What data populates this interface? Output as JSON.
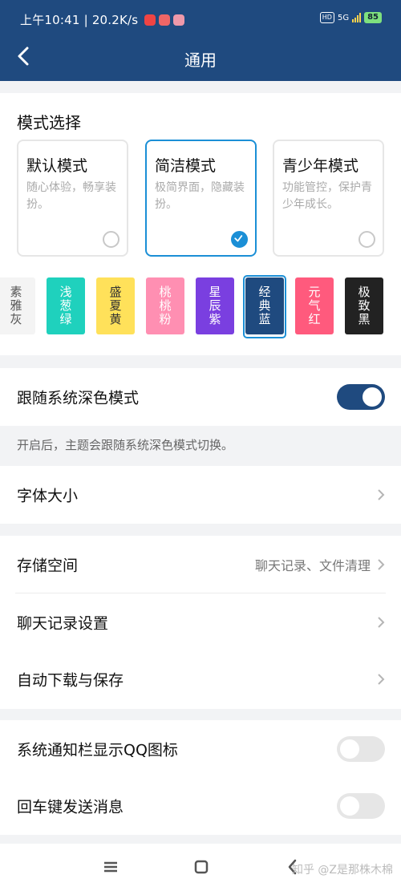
{
  "status_bar": {
    "time_speed": "上午10:41 | 20.2K/s",
    "network_label": "5G",
    "hd_label": "HD",
    "battery": "85"
  },
  "header": {
    "title": "通用"
  },
  "mode_section": {
    "title": "模式选择",
    "modes": [
      {
        "title": "默认模式",
        "desc": "随心体验，畅享装扮。",
        "selected": false
      },
      {
        "title": "简洁模式",
        "desc": "极简界面，隐藏装扮。",
        "selected": true
      },
      {
        "title": "青少年模式",
        "desc": "功能管控，保护青少年成长。",
        "selected": false
      }
    ],
    "themes": [
      {
        "label": "素雅灰",
        "color": "#f4f4f4",
        "text_color": "#555"
      },
      {
        "label": "浅葱绿",
        "color": "#1fd1bd",
        "text_color": "#ffffff"
      },
      {
        "label": "盛夏黄",
        "color": "#ffe15a",
        "text_color": "#333333"
      },
      {
        "label": "桃桃粉",
        "color": "#ff8fb2",
        "text_color": "#ffffff"
      },
      {
        "label": "星辰紫",
        "color": "#7a3fe0",
        "text_color": "#ffffff"
      },
      {
        "label": "经典蓝",
        "color": "#1f4a7f",
        "text_color": "#ffffff"
      },
      {
        "label": "元气红",
        "color": "#ff5a7d",
        "text_color": "#ffffff"
      },
      {
        "label": "极致黑",
        "color": "#222222",
        "text_color": "#ffffff"
      }
    ],
    "selected_theme": "经典蓝"
  },
  "dark_mode": {
    "label": "跟随系统深色模式",
    "enabled": true,
    "hint": "开启后，主题会跟随系统深色模式切换。"
  },
  "font_size": {
    "label": "字体大小"
  },
  "storage": {
    "label": "存储空间",
    "value": "聊天记录、文件清理"
  },
  "chat_history": {
    "label": "聊天记录设置"
  },
  "auto_download": {
    "label": "自动下载与保存"
  },
  "notify_icon": {
    "label": "系统通知栏显示QQ图标",
    "enabled": false
  },
  "enter_send": {
    "label": "回车键发送消息",
    "enabled": false
  },
  "watermark": "知乎 @Z是那株木棉",
  "colors": {
    "header": "#1f4a7f",
    "accent": "#1b8fd6"
  }
}
